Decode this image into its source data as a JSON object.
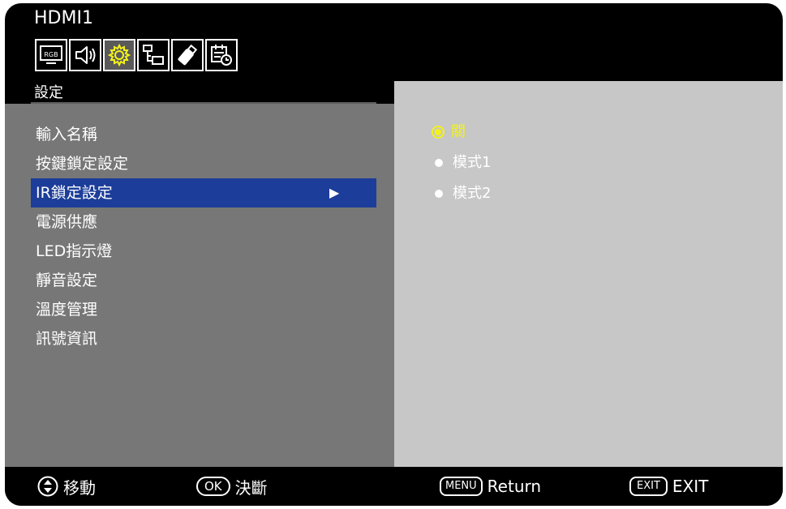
{
  "osd": {
    "source": "HDMI1",
    "tabs": [
      {
        "name": "rgb",
        "icon": "monitor-rgb-icon",
        "label": "RGB"
      },
      {
        "name": "audio",
        "icon": "speaker-icon"
      },
      {
        "name": "setup",
        "icon": "gear-icon",
        "active": true
      },
      {
        "name": "network",
        "icon": "network-icon"
      },
      {
        "name": "protect",
        "icon": "usb-drive-icon"
      },
      {
        "name": "schedule",
        "icon": "calendar-clock-icon"
      }
    ],
    "menu_title": "設定",
    "menu_items": [
      {
        "label": "輸入名稱"
      },
      {
        "label": "按鍵鎖定設定"
      },
      {
        "label": "IR鎖定設定",
        "selected": true
      },
      {
        "label": "電源供應"
      },
      {
        "label": "LED指示燈"
      },
      {
        "label": "靜音設定"
      },
      {
        "label": "溫度管理"
      },
      {
        "label": "訊號資訊"
      }
    ],
    "options": [
      {
        "label": "關",
        "selected": true
      },
      {
        "label": "模式1"
      },
      {
        "label": "模式2"
      }
    ]
  },
  "footer": {
    "move_label": "移動",
    "ok_key": "OK",
    "ok_label": "決斷",
    "menu_key": "MENU",
    "menu_label": "Return",
    "exit_key": "EXIT",
    "exit_label": "EXIT"
  },
  "colors": {
    "highlight": "#1c3d99",
    "active_option": "#f2f21c",
    "left_panel": "#777777",
    "right_panel": "#c7c7c7"
  }
}
